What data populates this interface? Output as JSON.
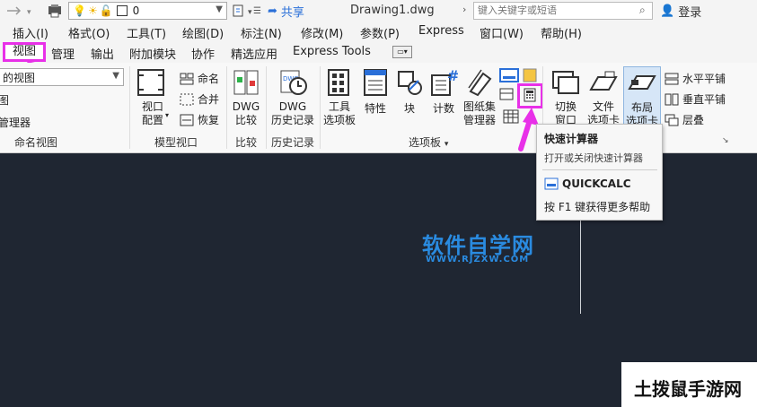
{
  "qat": {
    "layer_value": "0",
    "title": "Drawing1.dwg",
    "share_label": "共享",
    "search_placeholder": "键入关键字或短语",
    "login_label": "登录"
  },
  "menubar": {
    "items": [
      "插入(I)",
      "格式(O)",
      "工具(T)",
      "绘图(D)",
      "标注(N)",
      "修改(M)",
      "参数(P)",
      "Express",
      "窗口(W)",
      "帮助(H)"
    ]
  },
  "tabs": {
    "active": "视图",
    "items": [
      "管理",
      "输出",
      "附加模块",
      "协作",
      "精选应用",
      "Express Tools"
    ]
  },
  "ribbon": {
    "named_views": {
      "combo_value": "的视图",
      "items": [
        "图",
        "管理器"
      ],
      "label": "命名视图"
    },
    "model_viewports": {
      "viewport_config": [
        "视口",
        "配置"
      ],
      "named": "命名",
      "merge": "合并",
      "restore": "恢复",
      "label": "模型视口"
    },
    "compare": {
      "button": [
        "DWG",
        "比较"
      ],
      "label": "比较"
    },
    "history": {
      "button": [
        "DWG",
        "历史记录"
      ],
      "label": "历史记录"
    },
    "palettes": {
      "tool_palettes": [
        "工具",
        "选项板"
      ],
      "properties": "特性",
      "block": "块",
      "count": "计数",
      "sheet_set": [
        "图纸集",
        "管理器"
      ],
      "label": "选项板"
    },
    "interface": {
      "switch": [
        "切换",
        "窗口"
      ],
      "file": [
        "文件",
        "选项卡"
      ],
      "layout": [
        "布局",
        "选项卡"
      ],
      "tile_h": "水平平铺",
      "tile_v": "垂直平铺",
      "cascade": "层叠"
    }
  },
  "tooltip": {
    "title": "快速计算器",
    "desc": "打开或关闭快速计算器",
    "command": "QUICKCALC",
    "help": "按 F1 键获得更多帮助"
  },
  "watermark": {
    "main": "软件自学网",
    "sub": "WWW.RJZXW.COM"
  },
  "corner_brand": "土拨鼠手游网",
  "colors": {
    "accent": "#e830e8",
    "canvas": "#1f2632",
    "watermark": "#2a8be0"
  }
}
